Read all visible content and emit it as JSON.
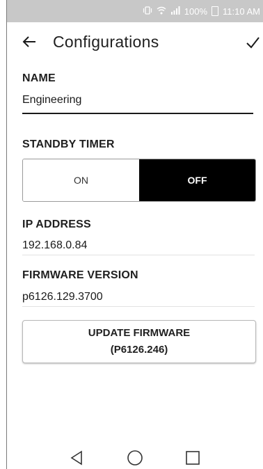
{
  "status_bar": {
    "battery": "100%",
    "time": "11:10 AM",
    "icons": [
      "vibrate-icon",
      "wifi-icon",
      "signal-icon",
      "battery-icon"
    ]
  },
  "app_bar": {
    "title": "Configurations",
    "back_icon": "arrow-left-icon",
    "confirm_icon": "check-icon"
  },
  "name_section": {
    "label": "NAME",
    "value": "Engineering"
  },
  "standby_section": {
    "label": "STANDBY TIMER",
    "on_label": "ON",
    "off_label": "OFF",
    "selected": "OFF"
  },
  "ip_section": {
    "label": "IP ADDRESS",
    "value": "192.168.0.84"
  },
  "firmware_section": {
    "label": "FIRMWARE VERSION",
    "value": "p6126.129.3700"
  },
  "update_button": {
    "line1": "UPDATE FIRMWARE",
    "line2": "(P6126.246)"
  },
  "nav_bar": {
    "icons": [
      "back-triangle-icon",
      "home-circle-icon",
      "recents-square-icon"
    ]
  },
  "colors": {
    "status_bar_bg": "#c8c8c8",
    "selected_segment_bg": "#000000",
    "text": "#1a1a1a"
  }
}
